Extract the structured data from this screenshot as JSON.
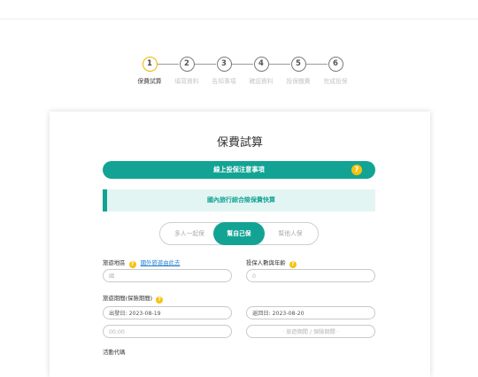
{
  "steps": [
    {
      "number": "1",
      "label": "保費試算"
    },
    {
      "number": "2",
      "label": "填寫資料"
    },
    {
      "number": "3",
      "label": "告知事項"
    },
    {
      "number": "4",
      "label": "確認資料"
    },
    {
      "number": "5",
      "label": "投保繳費"
    },
    {
      "number": "6",
      "label": "完成投保"
    }
  ],
  "card": {
    "title": "保費試算",
    "notice_button": "線上投保注意事項",
    "notice_icon": "?",
    "subtitle": "國內旅行綜合險保費快算"
  },
  "segments": [
    "多人一起保",
    "幫自己保",
    "幫他人保"
  ],
  "active_segment": "幫自己保",
  "form": {
    "region_label": "旅遊地區",
    "region_link": "國外旅遊由此去",
    "region_input": "國",
    "people_label": "投保人數與年齡",
    "people_input": "0",
    "period_label": "旅遊期間(保險期間)",
    "start_date": "出發日:  2023-08-19",
    "return_date": "返回日:  2023-08-20",
    "time_input": "00:00",
    "duration_placeholder": "· 旅遊期間 / 保險期間 ·",
    "promo_label": "活動代碼",
    "help_icon": "?"
  },
  "colors": {
    "accent": "#12a394",
    "highlight": "#f5c30f",
    "subtitle_bg": "#e3f5f2"
  }
}
